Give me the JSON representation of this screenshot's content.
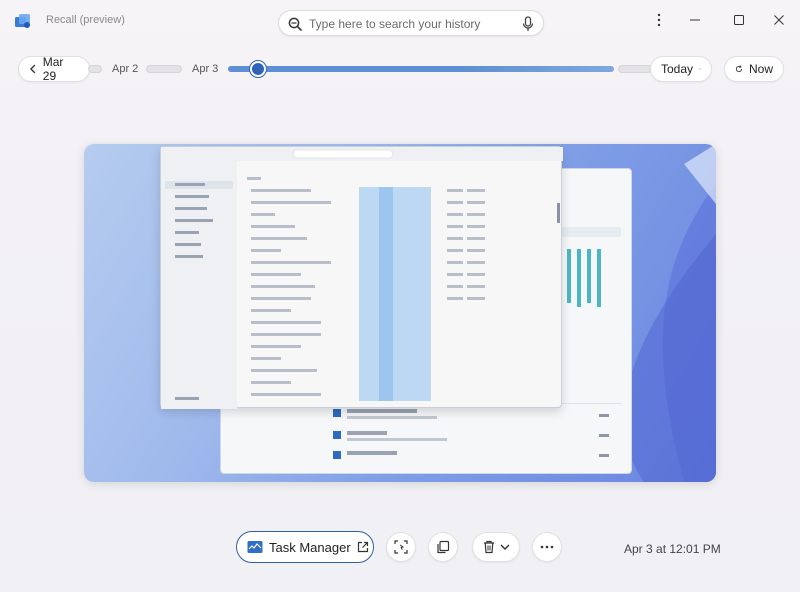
{
  "app": {
    "title": "Recall (preview)"
  },
  "search": {
    "placeholder": "Type here to search your history"
  },
  "timeline": {
    "start_label": "Mar 29",
    "dates": [
      "Apr 2",
      "Apr 3"
    ],
    "end_label": "Today",
    "now_label": "Now"
  },
  "snapshot": {
    "app_name": "Task Manager",
    "timestamp": "Apr 3 at 12:01 PM"
  },
  "colors": {
    "accent": "#2f63b8",
    "track": "#5d8fd3"
  }
}
